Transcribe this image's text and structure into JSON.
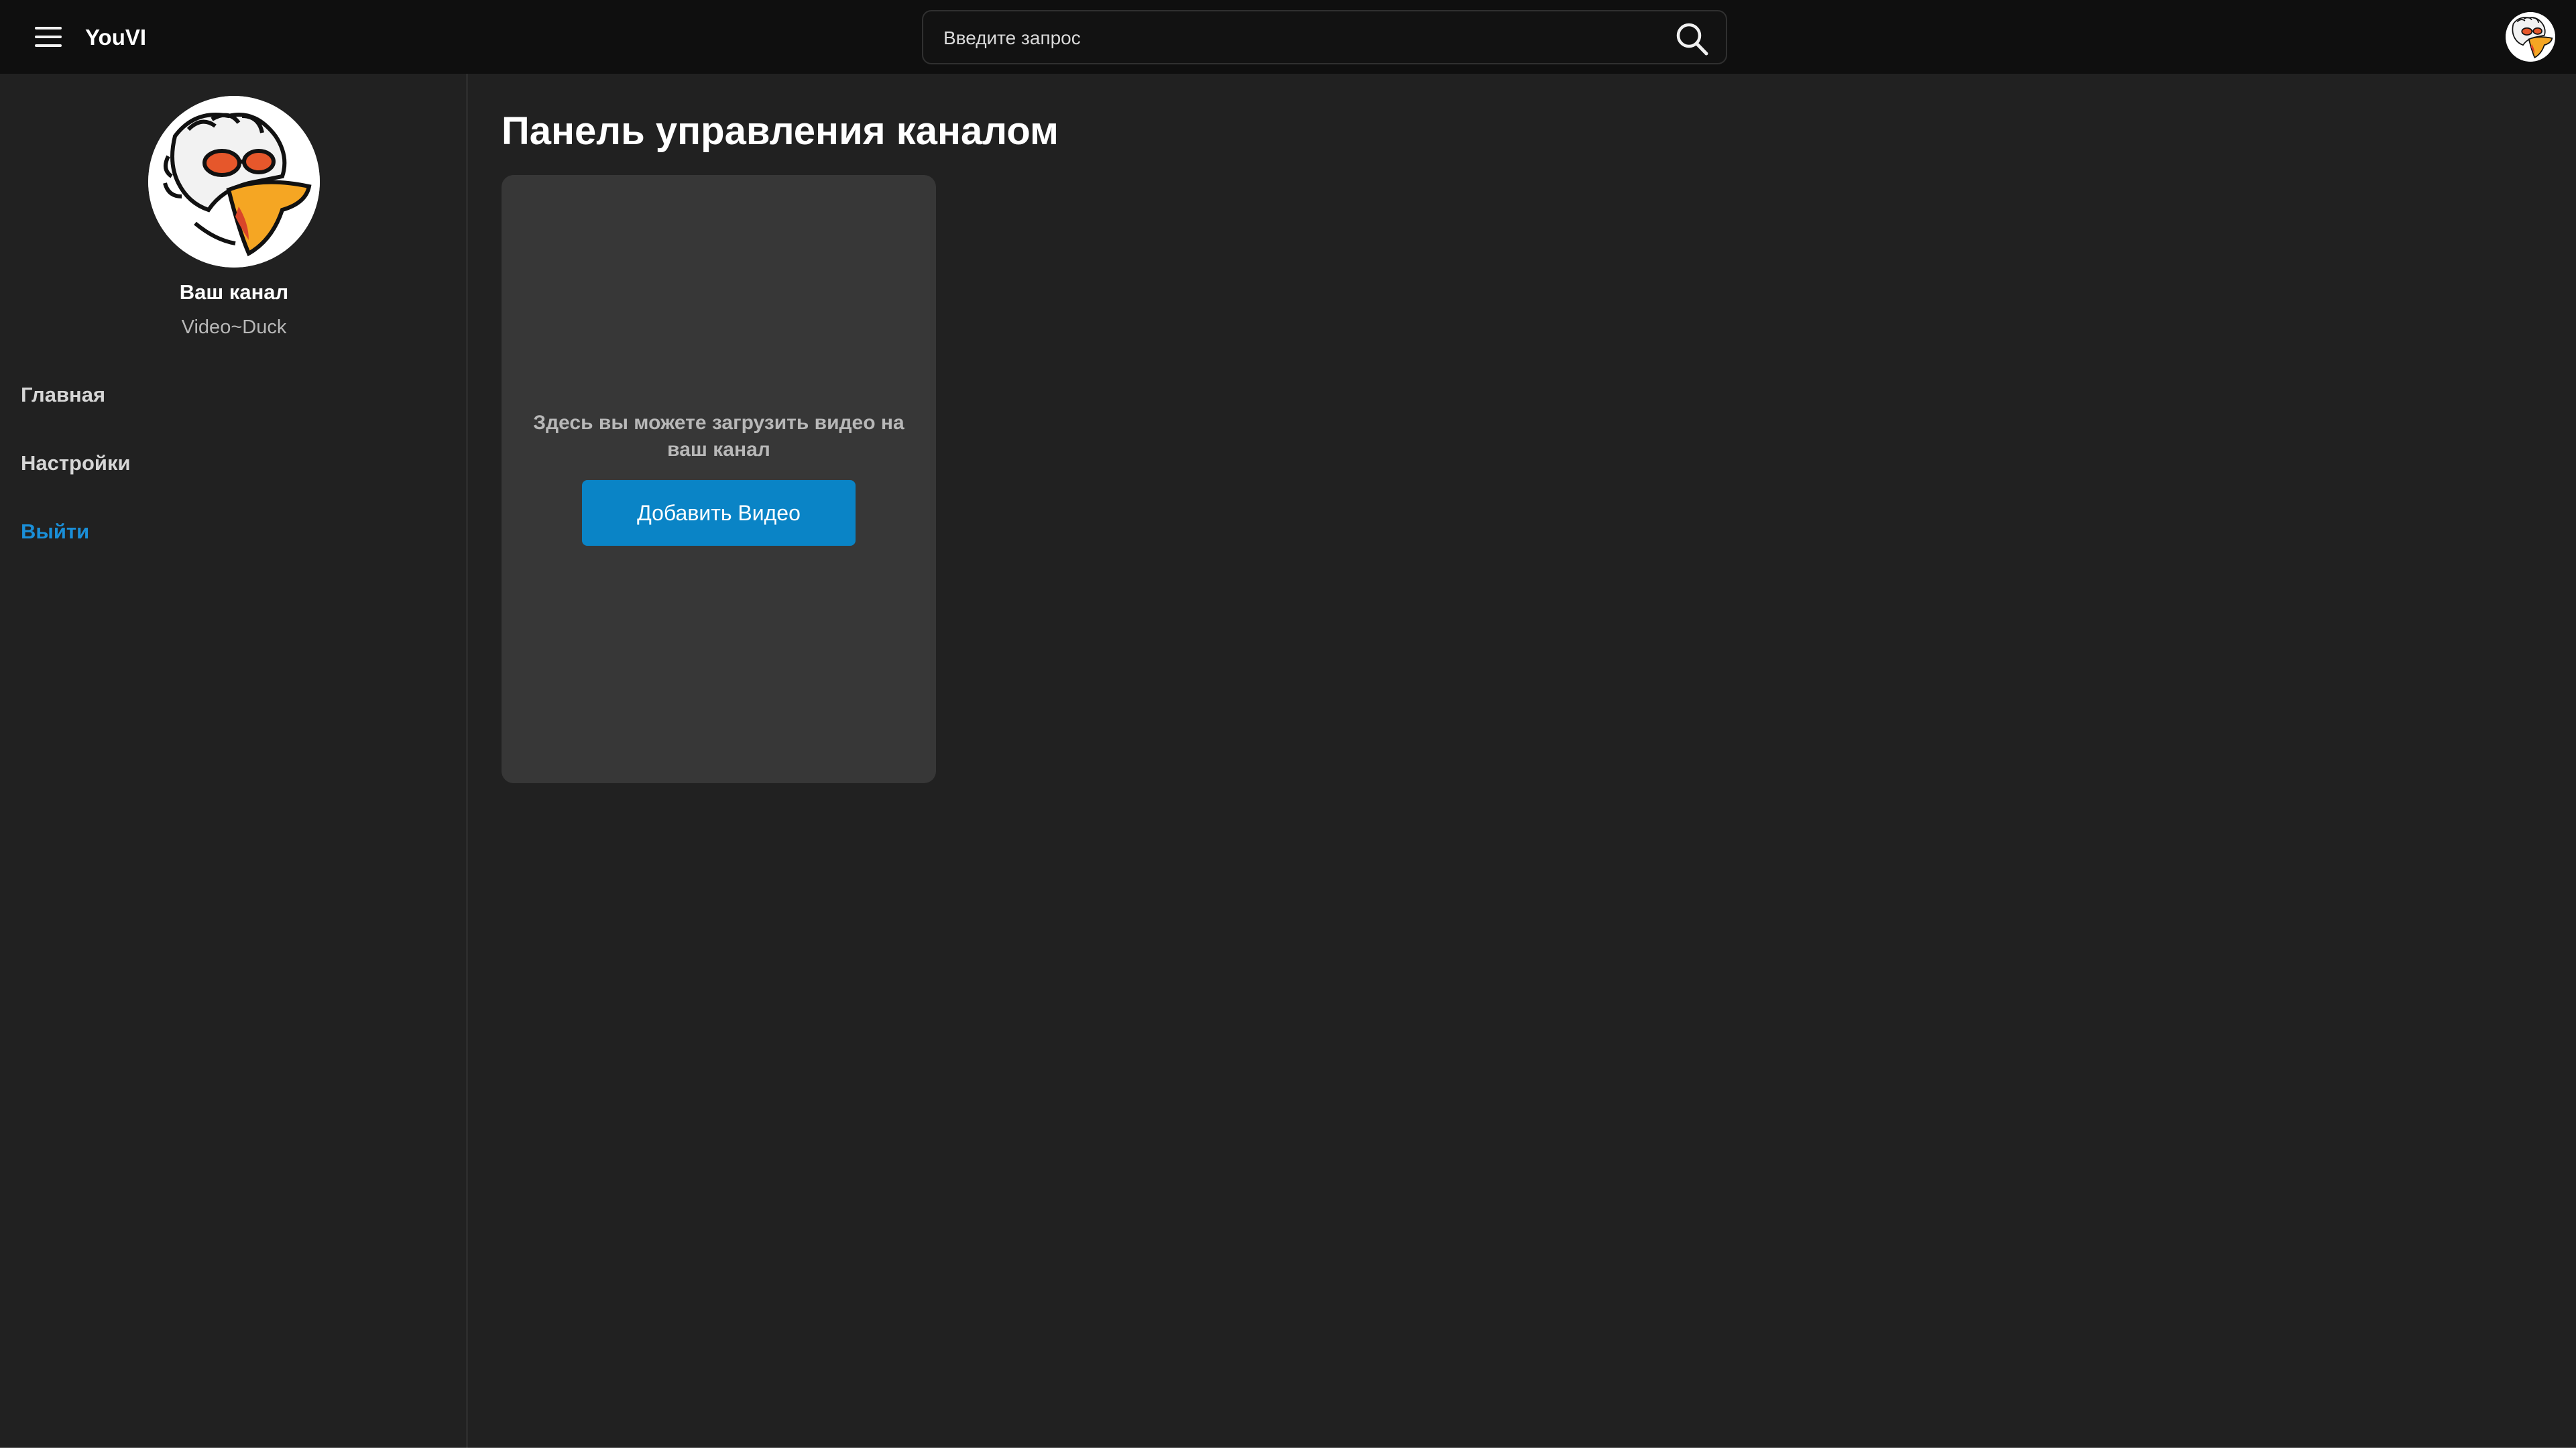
{
  "header": {
    "logo": "YouVI",
    "search": {
      "placeholder": "Введите запрос"
    }
  },
  "sidebar": {
    "channel_title": "Ваш канал",
    "channel_name": "Video~Duck",
    "nav": [
      {
        "label": "Главная"
      },
      {
        "label": "Настройки"
      },
      {
        "label": "Выйти"
      }
    ]
  },
  "main": {
    "title": "Панель управления каналом",
    "upload_card": {
      "text": "Здесь вы можете загрузить видео на ваш канал",
      "button_label": "Добавить Видео"
    }
  },
  "icons": {
    "menu": "hamburger-menu-icon",
    "search": "search-icon",
    "avatar": "duck-avatar"
  },
  "colors": {
    "background": "#212121",
    "topbar": "#0f0f0f",
    "card": "#373737",
    "accent_button": "#0a84c6",
    "logout_link": "#1a8fd8"
  }
}
